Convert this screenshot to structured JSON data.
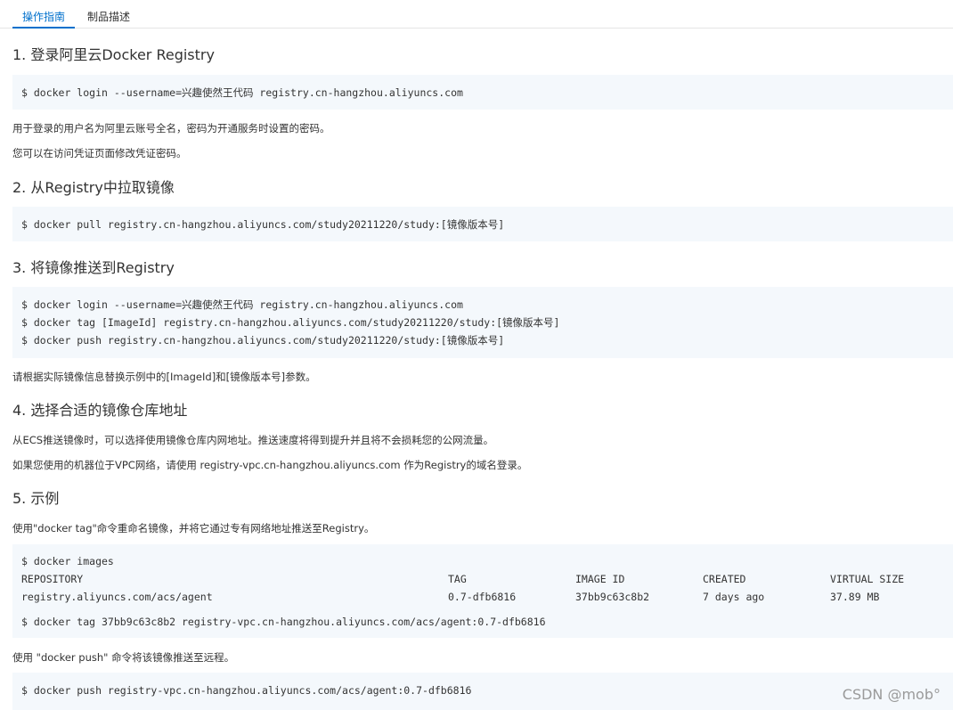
{
  "tabs": [
    "操作指南",
    "制品描述"
  ],
  "sections": [
    {
      "title": "1. 登录阿里云Docker Registry"
    },
    {
      "title": "2. 从Registry中拉取镜像"
    },
    {
      "title": "3. 将镜像推送到Registry"
    },
    {
      "title": "4. 选择合适的镜像仓库地址"
    },
    {
      "title": "5. 示例"
    }
  ],
  "s1": {
    "code": "$ docker login --username=兴趣使然王代码 registry.cn-hangzhou.aliyuncs.com",
    "p1": "用于登录的用户名为阿里云账号全名，密码为开通服务时设置的密码。",
    "p2": "您可以在访问凭证页面修改凭证密码。"
  },
  "s2": {
    "code": "$ docker pull registry.cn-hangzhou.aliyuncs.com/study20211220/study:[镜像版本号]"
  },
  "s3": {
    "code": [
      "$ docker login --username=兴趣使然王代码 registry.cn-hangzhou.aliyuncs.com",
      "$ docker tag [ImageId] registry.cn-hangzhou.aliyuncs.com/study20211220/study:[镜像版本号]",
      "$ docker push registry.cn-hangzhou.aliyuncs.com/study20211220/study:[镜像版本号]"
    ],
    "p1": "请根据实际镜像信息替换示例中的[ImageId]和[镜像版本号]参数。"
  },
  "s4": {
    "p1": "从ECS推送镜像时，可以选择使用镜像仓库内网地址。推送速度将得到提升并且将不会损耗您的公网流量。",
    "p2": "如果您使用的机器位于VPC网络，请使用 registry-vpc.cn-hangzhou.aliyuncs.com 作为Registry的域名登录。"
  },
  "s5": {
    "p1": "使用\"docker tag\"命令重命名镜像，并将它通过专有网络地址推送至Registry。",
    "cmd_images": "$ docker images",
    "table_headers": [
      "REPOSITORY",
      "TAG",
      "IMAGE ID",
      "CREATED",
      "VIRTUAL SIZE"
    ],
    "table_row": [
      "registry.aliyuncs.com/acs/agent",
      "0.7-dfb6816",
      "37bb9c63c8b2",
      "7 days ago",
      "37.89 MB"
    ],
    "cmd_tag": "$ docker tag 37bb9c63c8b2 registry-vpc.cn-hangzhou.aliyuncs.com/acs/agent:0.7-dfb6816",
    "p2": "使用 \"docker push\" 命令将该镜像推送至远程。",
    "cmd_push": "$ docker push registry-vpc.cn-hangzhou.aliyuncs.com/acs/agent:0.7-dfb6816"
  },
  "watermark": "CSDN @mob°",
  "colors": {
    "accent": "#0070cc",
    "code_bg": "#f4f8fc",
    "text": "#333333"
  }
}
